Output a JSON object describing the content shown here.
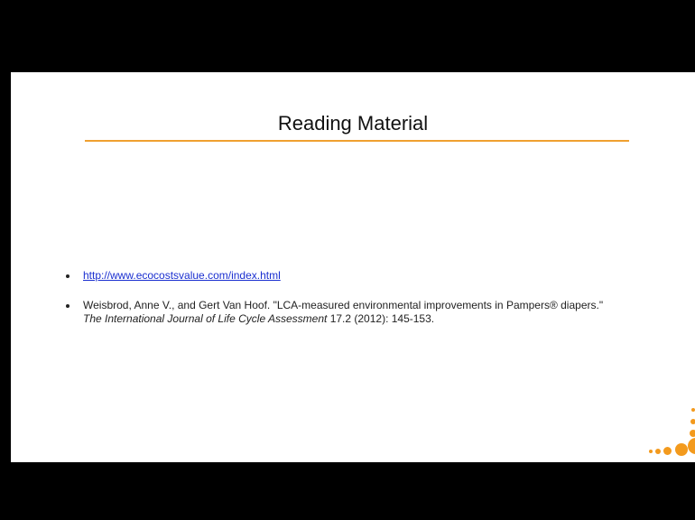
{
  "slide": {
    "title": "Reading Material",
    "bullets": [
      {
        "link_text": "http://www.ecocostsvalue.com/index.html"
      },
      {
        "citation_plain": "Weisbrod, Anne V., and Gert Van Hoof. \"LCA-measured environmental improvements in Pampers® diapers.\"",
        "journal_italic": "The International Journal of Life Cycle Assessment",
        "citation_tail": " 17.2 (2012): 145-153."
      }
    ]
  },
  "colors": {
    "accent": "#f0a030",
    "link": "#1a2fd0",
    "letterbox": "#000000"
  }
}
